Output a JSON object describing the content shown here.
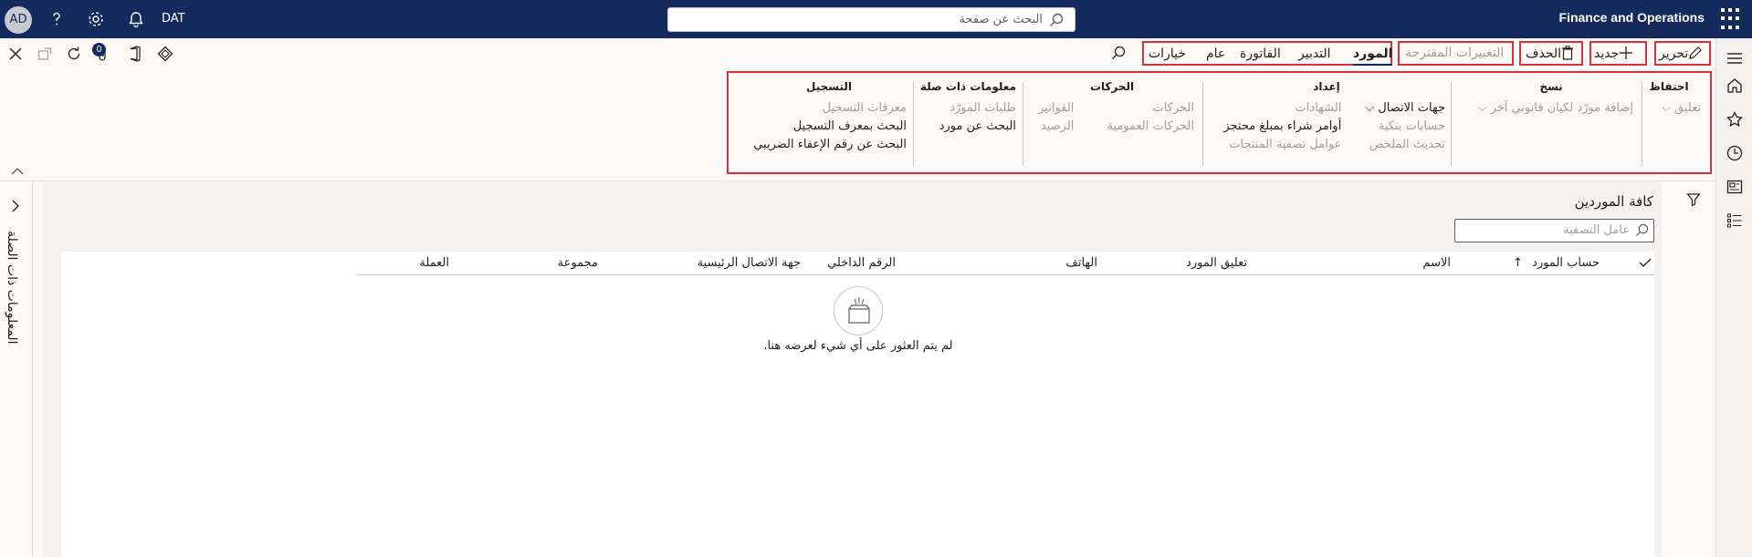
{
  "topbar": {
    "app_name": "Finance and Operations",
    "search_placeholder": "البحث عن صفحة",
    "company": "DAT",
    "avatar_initials": "AD"
  },
  "actions": {
    "edit": "تحرير",
    "new": "جديد",
    "delete": "الحذف",
    "suggested_changes": "التغييرات المقترحة"
  },
  "tabs": [
    "المورد",
    "التدبير",
    "الفاتورة",
    "عام",
    "خيارات"
  ],
  "right_toolbar": {
    "attachments_count": "0"
  },
  "ribbon": {
    "groups": [
      {
        "header": "احتفاظ",
        "items": [
          "تعليق"
        ]
      },
      {
        "header": "نسخ",
        "items": [
          "إضافة مورّد لكيان قانوني آخر"
        ]
      },
      {
        "header": "إعداد",
        "items": [
          "جهات الاتصال",
          "حسابات بنكية",
          "تحديث الملخص",
          "الشهادات",
          "أوامر شراء بمبلغ محتجز",
          "عوامل تصفية المنتجات"
        ]
      },
      {
        "header": "الحركات",
        "items": [
          "الحركات",
          "الحركات العمومية",
          "الفواتير",
          "الرصيد"
        ]
      },
      {
        "header": "معلومات ذات صلة",
        "items": [
          "طلبات المورّد",
          "البحث عن مورد"
        ]
      },
      {
        "header": "التسجيل",
        "items": [
          "معرفات التسجيل",
          "البحث بمعرف التسجيل",
          "البحث عن رقم الإعفاء الضريبي"
        ]
      }
    ]
  },
  "related_pane": {
    "label": "المعلومات ذات الصلة"
  },
  "page": {
    "title": "كافة الموردين",
    "filter_placeholder": "عامل التصفية"
  },
  "grid": {
    "columns": [
      "حساب المورد",
      "الاسم",
      "تعليق المورد",
      "الهاتف",
      "الرقم الداخلي",
      "جهة الاتصال الرئيسية",
      "مجموعة",
      "العملة"
    ],
    "empty_message": "لم يتم العثور على أي شيء لعرضه هنا."
  },
  "colors": {
    "topbar": "#142a5c",
    "highlight": "#e0303a"
  }
}
